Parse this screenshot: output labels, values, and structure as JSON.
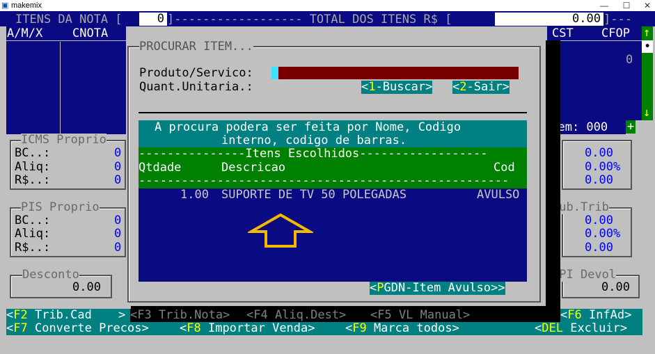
{
  "window": {
    "title": "makemix",
    "minimize": "—",
    "maximize": "☐",
    "close": "✕"
  },
  "header": {
    "itens_label": "ITENS DA NOTA [",
    "itens_value": "0",
    "itens_close": "]------------------ TOTAL DOS ITENS R$ [",
    "total_value": "0.00",
    "total_close": "]---"
  },
  "left_table": {
    "col1": "A/M/X",
    "col2": "CNOTA"
  },
  "right_table": {
    "col1": "CST",
    "col2": "CFOP",
    "value": "0",
    "item_label": "Item: 000",
    "plus": "+",
    "scroll_up": "↑",
    "scroll_thumb": "•",
    "scroll_down": "↓"
  },
  "icms": {
    "title": "ICMS Proprio",
    "bc_label": "BC..:",
    "bc_value": "0",
    "aliq_label": "Aliq:",
    "aliq_value": "0",
    "rs_label": "R$..:",
    "rs_value": "0",
    "right_bc": "0.00",
    "right_aliq": "0.00%",
    "right_rs": "0.00"
  },
  "pis": {
    "title": "PIS Proprio",
    "bc_label": "BC..:",
    "bc_value": "0",
    "aliq_label": "Aliq:",
    "aliq_value": "0",
    "rs_label": "R$..:",
    "rs_value": "0"
  },
  "subtrib": {
    "title": "Sub.Trib",
    "bc": "0.00",
    "aliq": "0.00%",
    "rs": "0.00"
  },
  "desconto": {
    "title": "Desconto",
    "value": "0.00"
  },
  "ipi": {
    "title": "IPI Devol",
    "value": "0.00"
  },
  "dialog": {
    "title": "PROCURAR ITEM...",
    "produto_label": "Produto/Servico:",
    "quant_label": "Quant.Unitaria.:",
    "buscar_open": "<",
    "buscar_key": "1",
    "buscar_text": "-Buscar>",
    "sair_open": "<",
    "sair_key": "2",
    "sair_text": "-Sair>",
    "info_line1": "A procura podera ser feita por Nome, Codigo",
    "info_line2": "interno, codigo de barras.",
    "chosen_header": "---------------Itens Escolhidos------------------",
    "col_qtd": "Qtdade",
    "col_desc": "Descricao",
    "col_cod": "Cod",
    "dashes": "----------------------------------------------------",
    "items": [
      {
        "qtd": "1.00",
        "desc": "SUPORTE DE TV 50 POLEGADAS",
        "cod": "AVULSO"
      }
    ],
    "pgdn_open": "<",
    "pgdn_key": "P",
    "pgdn_text": "GDN-Item Avulso>>"
  },
  "fkeys_row1": {
    "f2_key": "F2",
    "f2_text": " Trib.Cad",
    "f3": "<F3 Trib.Nota>",
    "f4": "<F4 Aliq.Dest>",
    "f5": "<F5 VL Manual>",
    "f6_key": "F6",
    "f6_text": " InfAd>"
  },
  "fkeys_row2": {
    "f7_key": "F7",
    "f7_text": " Converte Precos>",
    "f8_key": "F8",
    "f8_text": " Importar Venda>",
    "f9_key": "F9",
    "f9_text": " Marca todos>",
    "del_key": "DEL",
    "del_text": " Excluir>"
  },
  "colors": {
    "background": "#c0c0c0",
    "panel_blue": "#0a0a82",
    "teal": "#008080",
    "green": "#008000",
    "dark_red": "#7a0000",
    "highlight_yellow": "#ffff00",
    "arrow_orange": "#f5b800"
  }
}
